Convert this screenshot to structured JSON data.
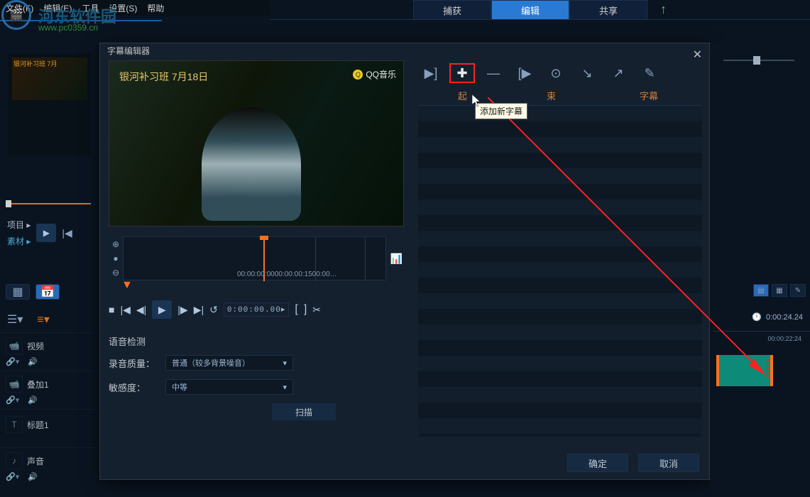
{
  "menu": {
    "file": "文件(F)",
    "edit": "编辑(E)",
    "tools": "工具",
    "settings": "设置(S)",
    "help": "帮助"
  },
  "brand": {
    "text": "河东软件园",
    "url": "www.pc0359.cn"
  },
  "modes": {
    "capture": "捕获",
    "edit": "编辑",
    "share": "共享"
  },
  "win": {
    "min": "—",
    "max": "☐",
    "close": "✕"
  },
  "side_thumb": {
    "title": "银河补习班 7月"
  },
  "proj": {
    "project": "项目 ▸",
    "material": "素材 ▸"
  },
  "modal": {
    "title": "字幕编辑器",
    "video_text": "银河补习班  7月18日",
    "qq": "QQ音乐",
    "tl": {
      "t0": "00:00:00:00",
      "t1": "00:00:00:15",
      "t2": "00:00…"
    },
    "timecode": "0:00:00.00▸",
    "voice": {
      "heading": "语音检测",
      "quality_label": "录音质量：",
      "quality_value": "普通（较多背景噪音）",
      "sensitivity_label": "敏感度：",
      "sensitivity_value": "中等",
      "scan": "扫描"
    },
    "sub_toolbar": {
      "add_tooltip": "添加新字幕"
    },
    "headers": {
      "start": "起",
      "end": "束",
      "subtitle": "字幕"
    },
    "ok": "确定",
    "cancel": "取消"
  },
  "tracks": {
    "video": "视频",
    "overlay": "叠加1",
    "title": "标题1",
    "audio": "声音"
  },
  "right": {
    "timecode": "0:00:24.24",
    "ruler": "00:00:22:24"
  }
}
